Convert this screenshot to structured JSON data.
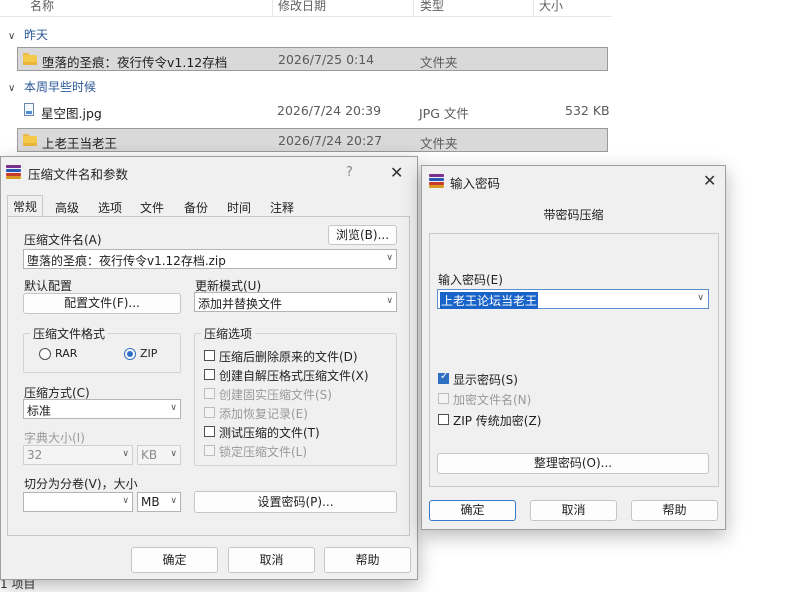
{
  "explorer": {
    "columns": {
      "name": "名称",
      "date": "修改日期",
      "type": "类型",
      "size": "大小"
    },
    "groups": [
      {
        "label": "昨天"
      },
      {
        "label": "本周早些时候"
      }
    ],
    "rows": [
      {
        "name": "堕落的圣痕：夜行传令v1.12存档",
        "date": "2026/7/25 0:14",
        "type": "文件夹",
        "size": "",
        "icon": "folder-icon"
      },
      {
        "name": "星空图.jpg",
        "date": "2026/7/24 20:39",
        "type": "JPG 文件",
        "size": "532 KB",
        "icon": "image-file-icon"
      },
      {
        "name": "上老王当老王",
        "date": "2026/7/24 20:27",
        "type": "文件夹",
        "size": "",
        "icon": "folder-icon"
      }
    ],
    "footer": "1 项目"
  },
  "archive_dialog": {
    "title": "压缩文件名和参数",
    "help": "?",
    "close": "✕",
    "tabs": [
      "常规",
      "高级",
      "选项",
      "文件",
      "备份",
      "时间",
      "注释"
    ],
    "archive_name_label": "压缩文件名(A)",
    "browse_button": "浏览(B)...",
    "archive_name_value": "堕落的圣痕：夜行传令v1.12存档.zip",
    "default_profile_label": "默认配置",
    "profiles_button": "配置文件(F)...",
    "update_mode_label": "更新模式(U)",
    "update_mode_value": "添加并替换文件",
    "format_group": "压缩文件格式",
    "format_rar": "RAR",
    "format_zip": "ZIP",
    "options_group": "压缩选项",
    "options": [
      {
        "label": "压缩后删除原来的文件(D)",
        "enabled": true,
        "checked": false
      },
      {
        "label": "创建自解压格式压缩文件(X)",
        "enabled": true,
        "checked": false
      },
      {
        "label": "创建固实压缩文件(S)",
        "enabled": false,
        "checked": false
      },
      {
        "label": "添加恢复记录(E)",
        "enabled": false,
        "checked": false
      },
      {
        "label": "测试压缩的文件(T)",
        "enabled": true,
        "checked": false
      },
      {
        "label": "锁定压缩文件(L)",
        "enabled": false,
        "checked": false
      }
    ],
    "method_label": "压缩方式(C)",
    "method_value": "标准",
    "dict_label": "字典大小(I)",
    "dict_value": "32",
    "dict_unit": "KB",
    "split_label": "切分为分卷(V)，大小",
    "split_value": "",
    "split_unit": "MB",
    "set_password_button": "设置密码(P)...",
    "ok_button": "确定",
    "cancel_button": "取消",
    "help_button": "帮助"
  },
  "password_dialog": {
    "title": "输入密码",
    "close": "✕",
    "heading": "带密码压缩",
    "enter_password_label": "输入密码(E)",
    "password_value": "上老王论坛当老王",
    "show_password": "显示密码(S)",
    "encrypt_names": "加密文件名(N)",
    "zip_legacy": "ZIP 传统加密(Z)",
    "organize_button": "整理密码(O)...",
    "ok_button": "确定",
    "cancel_button": "取消",
    "help_button": "帮助"
  },
  "colors": {
    "accent": "#2f6fc2",
    "selection": "#1a63c8",
    "group_header": "#2b5797",
    "folder": "#f5c94a"
  }
}
